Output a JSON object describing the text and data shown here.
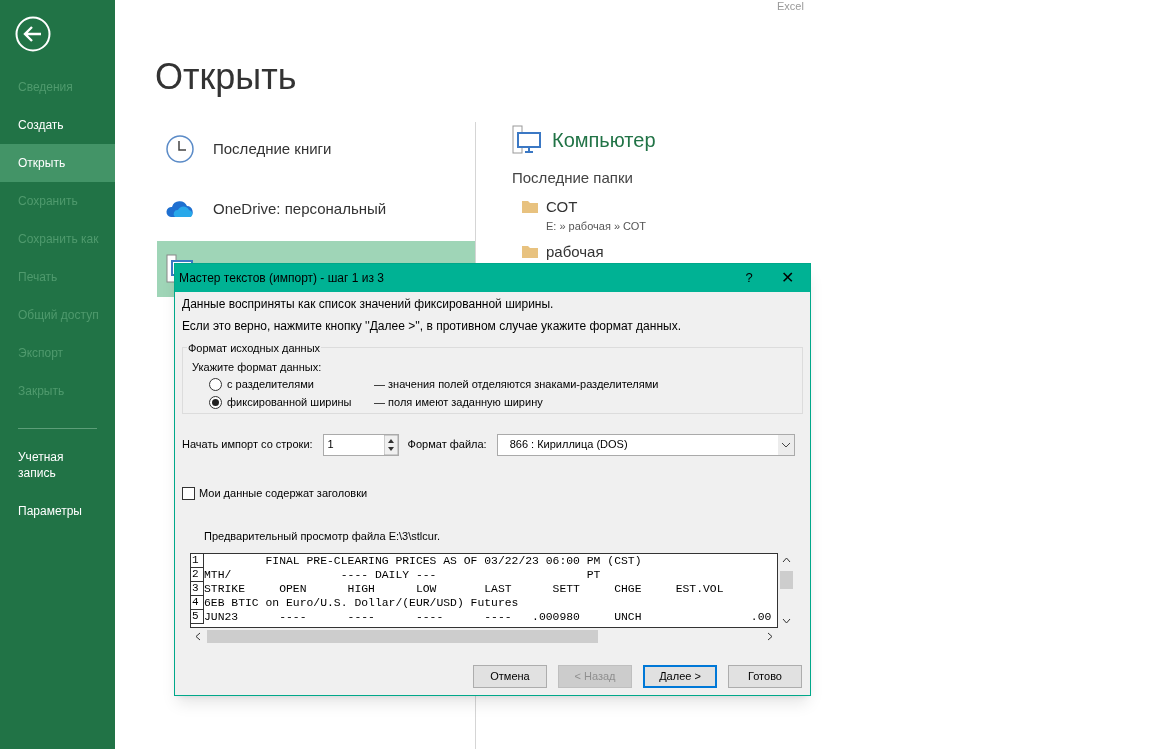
{
  "app_name": "Excel",
  "sidebar": {
    "items": [
      {
        "label": "Сведения",
        "disabled": true,
        "selected": false
      },
      {
        "label": "Создать",
        "disabled": false,
        "selected": false
      },
      {
        "label": "Открыть",
        "disabled": false,
        "selected": true
      },
      {
        "label": "Сохранить",
        "disabled": true,
        "selected": false
      },
      {
        "label": "Сохранить как",
        "disabled": true,
        "selected": false
      },
      {
        "label": "Печать",
        "disabled": true,
        "selected": false
      },
      {
        "label": "Общий доступ",
        "disabled": true,
        "selected": false
      },
      {
        "label": "Экспорт",
        "disabled": true,
        "selected": false
      },
      {
        "label": "Закрыть",
        "disabled": true,
        "selected": false
      }
    ],
    "footer_items": [
      "Учетная запись",
      "Параметры"
    ]
  },
  "page_title": "Открыть",
  "places": [
    {
      "kind": "recent",
      "label": "Последние книги",
      "selected": false
    },
    {
      "kind": "onedrive",
      "label": "OneDrive: персональный",
      "selected": false
    },
    {
      "kind": "computer",
      "selected": true
    }
  ],
  "location": {
    "title": "Компьютер",
    "section": "Последние папки",
    "folders": [
      {
        "name": "СОТ",
        "path": "E: » рабочая » СОТ"
      },
      {
        "name": "рабочая"
      }
    ]
  },
  "dialog": {
    "title": "Мастер текстов (импорт) - шаг 1 из 3",
    "help": "?",
    "close": "✕",
    "intro": [
      "Данные восприняты как список значений фиксированной ширины.",
      "Если это верно, нажмите кнопку ''Далее >'', в противном случае укажите формат данных."
    ],
    "group": {
      "legend": "Формат исходных данных",
      "prompt": "Укажите формат данных:",
      "options": [
        {
          "label": "с разделителями",
          "description": "— значения полей отделяются знаками-разделителями",
          "selected": false
        },
        {
          "label": "фиксированной ширины",
          "description": "— поля имеют заданную ширину",
          "selected": true
        }
      ]
    },
    "start_row": {
      "label": "Начать импорт со строки:",
      "value": "1"
    },
    "file_origin": {
      "label": "Формат файла:",
      "value": "866 : Кириллица (DOS)"
    },
    "headers": {
      "label": "Мои данные содержат заголовки",
      "checked": false
    },
    "preview": {
      "label": "Предварительный просмотр файла E:\\3\\stlcur.",
      "rows": [
        {
          "number": "1",
          "text": "         FINAL PRE-CLEARING PRICES AS OF 03/22/23 06:00 PM (CST)"
        },
        {
          "number": "2",
          "text": "MTH/                ---- DAILY ---                      PT"
        },
        {
          "number": "3",
          "text": "STRIKE     OPEN      HIGH      LOW       LAST      SETT     CHGE     EST.VOL"
        },
        {
          "number": "4",
          "text": "6EB BTIC on Euro/U.S. Dollar/(EUR/USD) Futures"
        },
        {
          "number": "5",
          "text": "JUN23      ----      ----      ----      ----   .000980     UNCH                .00"
        }
      ]
    },
    "buttons": [
      {
        "label": "Отмена",
        "disabled": false,
        "default": false
      },
      {
        "label": "< Назад",
        "disabled": true,
        "default": false
      },
      {
        "label": "Далее >",
        "disabled": false,
        "default": true
      },
      {
        "label": "Готово",
        "disabled": false,
        "default": false
      }
    ]
  }
}
